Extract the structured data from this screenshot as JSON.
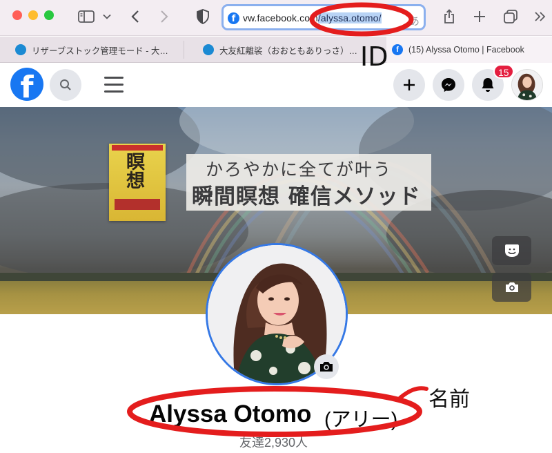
{
  "browser": {
    "url_prefix": "vw.facebook.co",
    "url_mid": "m",
    "url_selected": "/alyssa.otomo/",
    "accent_url_focus": "#8bb0ee",
    "icons": [
      "close-dot",
      "minimize-dot",
      "zoom-dot",
      "sidebar-icon",
      "chevron-down-icon",
      "back-icon",
      "forward-icon",
      "shield-icon",
      "translate-icon",
      "share-icon",
      "plus-icon",
      "tabs-overview-icon",
      "more-chevron-icon"
    ]
  },
  "tabs": [
    {
      "label": "リザーブストック管理モード - 大…",
      "icon": "reservestock-icon"
    },
    {
      "label": "大友紅離裟（おおともありっさ）…",
      "icon": "reservestock-icon"
    },
    {
      "label": "(15) Alyssa Otomo | Facebook",
      "icon": "facebook-icon"
    }
  ],
  "facebook": {
    "logo": "f",
    "brand_color": "#1877f2",
    "notification_count": "15",
    "icons": [
      "search-icon",
      "menu-icon",
      "create-plus-icon",
      "messenger-icon",
      "bell-icon",
      "avatar"
    ]
  },
  "cover": {
    "book_title": "瞑想",
    "banner_line1": "かろやかに全てが叶う",
    "banner_line2": "瞬間瞑想 確信メソッド"
  },
  "profile": {
    "name": "Alyssa Otomo",
    "name_alt": "(アリー)",
    "friends": "友達2,930人"
  },
  "annotations": {
    "id_label": "ID",
    "name_label": "名前",
    "mark_color": "#e41d1d"
  }
}
